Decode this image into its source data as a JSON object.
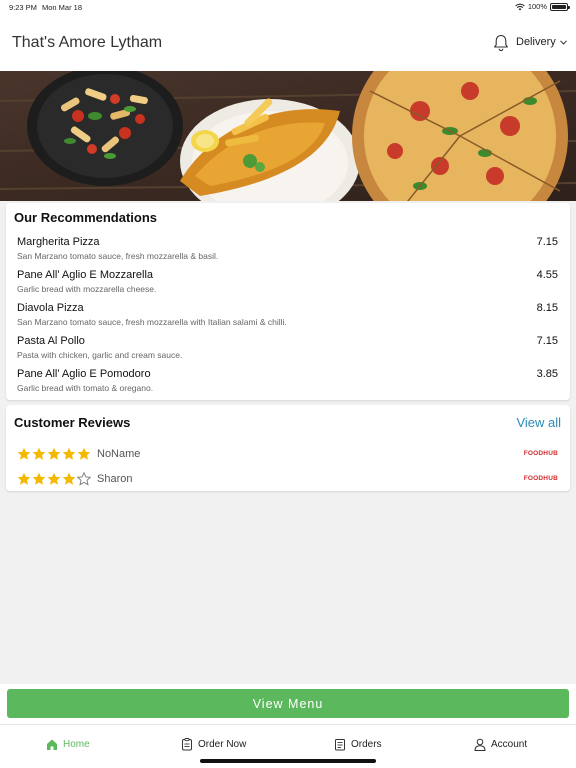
{
  "status_bar": {
    "time": "9:23 PM",
    "date": "Mon Mar 18",
    "battery": "100%"
  },
  "header": {
    "title": "That's Amore Lytham",
    "delivery_label": "Delivery"
  },
  "recommendations": {
    "title": "Our Recommendations",
    "items": [
      {
        "name": "Margherita Pizza",
        "desc": "San Marzano tomato sauce, fresh mozzarella & basil.",
        "price": "7.15"
      },
      {
        "name": "Pane All' Aglio E Mozzarella",
        "desc": "Garlic bread with mozzarella cheese.",
        "price": "4.55"
      },
      {
        "name": "Diavola Pizza",
        "desc": "San Marzano tomato sauce, fresh mozzarella with Italian salami & chilli.",
        "price": "8.15"
      },
      {
        "name": "Pasta Al Pollo",
        "desc": "Pasta with chicken, garlic and cream sauce.",
        "price": "7.15"
      },
      {
        "name": "Pane All' Aglio E Pomodoro",
        "desc": "Garlic bread with tomato & oregano.",
        "price": "3.85"
      }
    ]
  },
  "reviews": {
    "title": "Customer Reviews",
    "view_all": "View all",
    "items": [
      {
        "name": "NoName",
        "rating": 5,
        "source": "FOODHUB"
      },
      {
        "name": "Sharon",
        "rating": 4,
        "source": "FOODHUB"
      }
    ]
  },
  "view_menu_label": "View Menu",
  "tabs": [
    {
      "label": "Home",
      "icon": "home-icon",
      "active": true
    },
    {
      "label": "Order Now",
      "icon": "order-icon",
      "active": false
    },
    {
      "label": "Orders",
      "icon": "orders-icon",
      "active": false
    },
    {
      "label": "Account",
      "icon": "account-icon",
      "active": false
    }
  ],
  "colors": {
    "accent_green": "#5cb85c",
    "link_blue": "#2a8bb5",
    "star_gold": "#f5b800",
    "foodhub_red": "#d42a2a"
  }
}
